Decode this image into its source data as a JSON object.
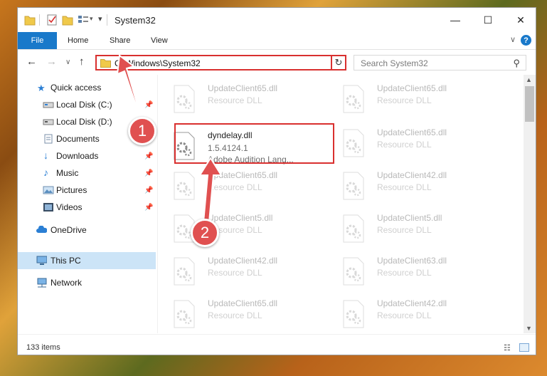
{
  "window": {
    "title": "System32"
  },
  "ribbon": {
    "tabs": [
      {
        "label": "File"
      },
      {
        "label": "Home"
      },
      {
        "label": "Share"
      },
      {
        "label": "View"
      }
    ]
  },
  "navigation": {
    "address": "C:\\Windows\\System32",
    "search_placeholder": "Search System32"
  },
  "sidebar": {
    "items": [
      {
        "label": "Quick access",
        "icon": "star-icon"
      },
      {
        "label": "Local Disk (C:)",
        "icon": "drive-icon",
        "pinned": true
      },
      {
        "label": "Local Disk (D:)",
        "icon": "drive-icon",
        "pinned": false
      },
      {
        "label": "Documents",
        "icon": "documents-icon",
        "pinned": true
      },
      {
        "label": "Downloads",
        "icon": "downloads-icon",
        "pinned": true
      },
      {
        "label": "Music",
        "icon": "music-icon",
        "pinned": true
      },
      {
        "label": "Pictures",
        "icon": "pictures-icon",
        "pinned": true
      },
      {
        "label": "Videos",
        "icon": "videos-icon",
        "pinned": true
      },
      {
        "label": "OneDrive",
        "icon": "cloud-icon"
      },
      {
        "label": "This PC",
        "icon": "computer-icon",
        "selected": true
      },
      {
        "label": "Network",
        "icon": "network-icon"
      }
    ]
  },
  "files": {
    "left": [
      {
        "name": "UpdateClient65.dll",
        "sub": "Resource DLL",
        "faded": true
      },
      {
        "name": "dyndelay.dll",
        "version": "1.5.4124.1",
        "sub": "Adobe Audition Lang...",
        "faded": false
      },
      {
        "name": "UpdateClient65.dll",
        "sub": "Resource DLL",
        "faded": true
      },
      {
        "name": "UpdateClient5.dll",
        "sub": "Resource DLL",
        "faded": true
      },
      {
        "name": "UpdateClient42.dll",
        "sub": "Resource DLL",
        "faded": true
      },
      {
        "name": "UpdateClient65.dll",
        "sub": "Resource DLL",
        "faded": true
      }
    ],
    "right": [
      {
        "name": "UpdateClient65.dll",
        "sub": "Resource DLL"
      },
      {
        "name": "UpdateClient65.dll",
        "sub": "Resource DLL"
      },
      {
        "name": "UpdateClient42.dll",
        "sub": "Resource DLL"
      },
      {
        "name": "UpdateClient5.dll",
        "sub": "Resource DLL"
      },
      {
        "name": "UpdateClient63.dll",
        "sub": "Resource DLL"
      },
      {
        "name": "UpdateClient42.dll",
        "sub": "Resource DLL"
      }
    ]
  },
  "status": {
    "item_count": "133 items"
  },
  "annotations": {
    "step1": "1",
    "step2": "2",
    "color": "#e05050"
  },
  "colors": {
    "accent": "#1979ca",
    "highlight": "#d9302f",
    "selected_bg": "#cce4f7"
  }
}
